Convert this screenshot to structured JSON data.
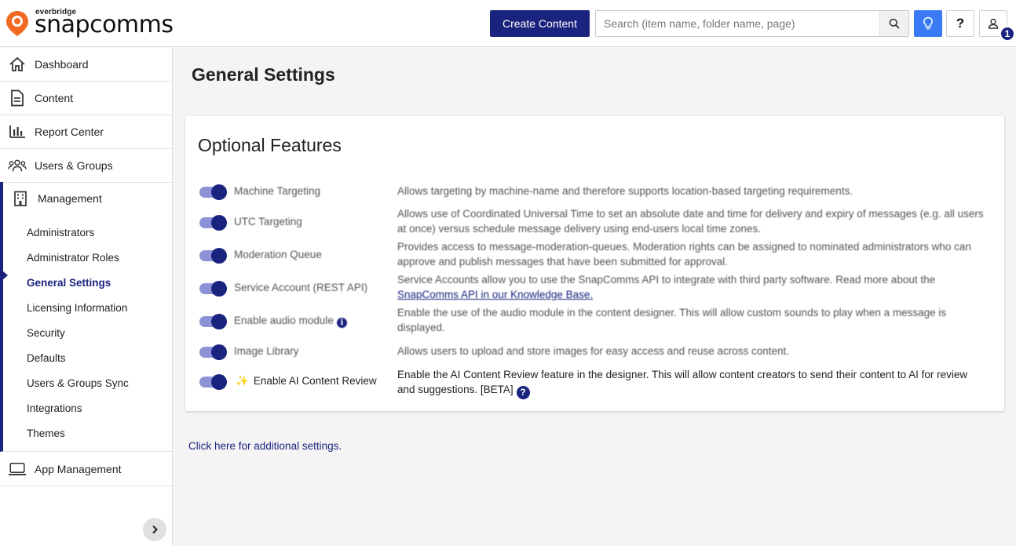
{
  "brand": {
    "company": "everbridge",
    "product": "snapcomms",
    "mark_color": "#f26a21"
  },
  "header": {
    "create_label": "Create Content",
    "search_placeholder": "Search (item name, folder name, page)",
    "help_label": "?",
    "user_badge": "1",
    "accent": "#1a237e",
    "idea_color": "#3a7bf5"
  },
  "sidebar": {
    "items": [
      {
        "label": "Dashboard",
        "icon": "home-icon"
      },
      {
        "label": "Content",
        "icon": "document-icon"
      },
      {
        "label": "Report Center",
        "icon": "bar-chart-icon"
      },
      {
        "label": "Users & Groups",
        "icon": "users-icon"
      }
    ],
    "management": {
      "label": "Management",
      "icon": "building-icon",
      "subitems": [
        "Administrators",
        "Administrator Roles",
        "General Settings",
        "Licensing Information",
        "Security",
        "Defaults",
        "Users & Groups Sync",
        "Integrations",
        "Themes"
      ],
      "active": "General Settings"
    },
    "app_management": {
      "label": "App Management",
      "icon": "laptop-icon"
    }
  },
  "main": {
    "title": "General Settings",
    "card_title": "Optional Features",
    "features": [
      {
        "label": "Machine Targeting",
        "enabled": true,
        "description": "Allows targeting by machine-name and therefore supports location-based targeting requirements."
      },
      {
        "label": "UTC Targeting",
        "enabled": true,
        "description": "Allows use of Coordinated Universal Time to set an absolute date and time for delivery and expiry of messages (e.g. all users at once) versus schedule message delivery using end-users local time zones."
      },
      {
        "label": "Moderation Queue",
        "enabled": true,
        "description": "Provides access to message-moderation-queues. Moderation rights can be assigned to nominated administrators who can approve and publish messages that have been submitted for approval."
      },
      {
        "label": "Service Account (REST API)",
        "enabled": true,
        "description": "Service Accounts allow you to use the SnapComms API to integrate with third party software. Read more about the",
        "link": "SnapComms API in our Knowledge Base."
      },
      {
        "label": "Enable audio module",
        "enabled": true,
        "description": "Enable the use of the audio module in the content designer. This will allow custom sounds to play when a message is displayed."
      },
      {
        "label": "Image Library",
        "enabled": true,
        "description": "Allows users to upload and store images for easy access and reuse across content."
      },
      {
        "label": "Enable AI Content Review",
        "enabled": true,
        "description": "Enable the AI Content Review feature in the designer. This will allow content creators to send their content to AI for review and suggestions. [BETA]"
      }
    ],
    "more_link": "Click here for additional settings."
  }
}
